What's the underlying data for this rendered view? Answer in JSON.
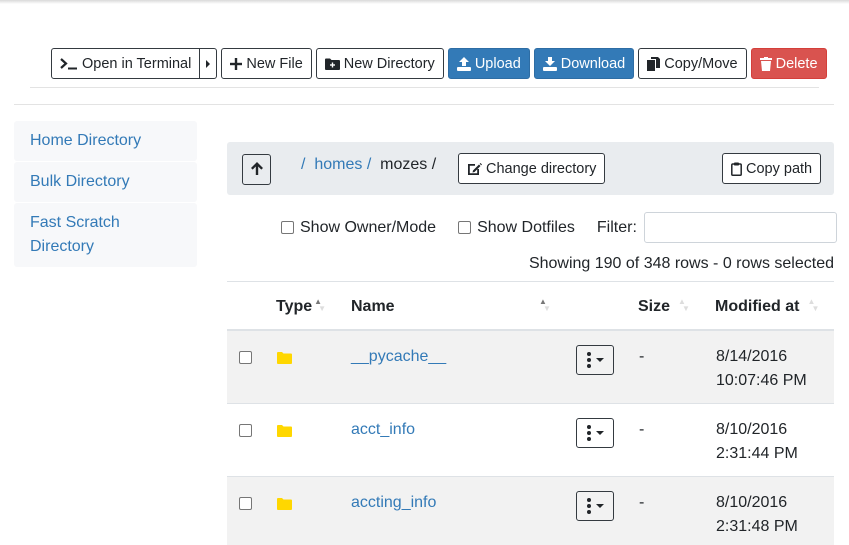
{
  "toolbar": {
    "open_terminal": "Open in Terminal",
    "new_file": "New File",
    "new_directory": "New Directory",
    "upload": "Upload",
    "download": "Download",
    "copy_move": "Copy/Move",
    "delete": "Delete"
  },
  "colors": {
    "primary": "#337ab7",
    "danger": "#d9534f",
    "folder": "#ffd700",
    "sidebar_bg": "#f7f8fa",
    "crumbbar_bg": "#e9ecef"
  },
  "sidebar": {
    "items": [
      {
        "label": "Home Directory"
      },
      {
        "label": "Bulk Directory"
      },
      {
        "label": "Fast Scratch Directory"
      }
    ]
  },
  "breadcrumb": {
    "root_sep": "/",
    "items": [
      {
        "label": "homes",
        "sep": "/"
      },
      {
        "label": "mozes",
        "sep": "/"
      }
    ],
    "change_directory": "Change directory",
    "copy_path": "Copy path"
  },
  "filters": {
    "show_owner_mode": "Show Owner/Mode",
    "show_dotfiles": "Show Dotfiles",
    "filter_label": "Filter:",
    "filter_value": "",
    "filter_placeholder": ""
  },
  "status": "Showing 190 of 348 rows - 0 rows selected",
  "table": {
    "columns": {
      "type": "Type",
      "name": "Name",
      "size": "Size",
      "modified": "Modified at"
    },
    "rows": [
      {
        "type_icon": "folder-icon",
        "name": "__pycache__",
        "size": "-",
        "date": "8/14/2016",
        "time": "10:07:46 PM"
      },
      {
        "type_icon": "folder-icon",
        "name": "acct_info",
        "size": "-",
        "date": "8/10/2016",
        "time": "2:31:44 PM"
      },
      {
        "type_icon": "folder-icon",
        "name": "accting_info",
        "size": "-",
        "date": "8/10/2016",
        "time": "2:31:48 PM"
      }
    ]
  }
}
